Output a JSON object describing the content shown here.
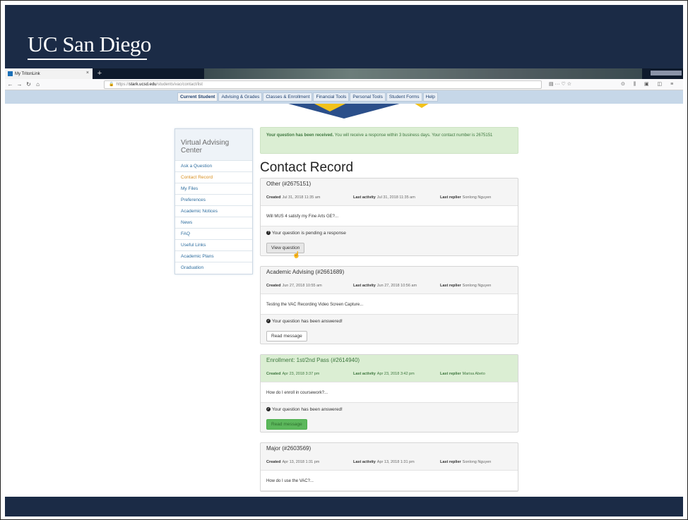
{
  "slide": {
    "logo_text": "UC San Diego"
  },
  "browser": {
    "tab_title": "My TritonLink",
    "tab_close": "×",
    "new_tab": "+",
    "back": "←",
    "forward": "→",
    "reload": "↻",
    "home": "⌂",
    "url_prefix": "https://",
    "url_host": "stark.ucsd.edu",
    "url_path": "/students/vac/contact/list",
    "url_tools": "▤   ··· ♡ ☆",
    "toolbar_icons": "⊙ ⫼ ▣ ◫ ≡"
  },
  "menu": {
    "items": [
      "Current Student",
      "Advising & Grades",
      "Classes & Enrollment",
      "Financial Tools",
      "Personal Tools",
      "Student Forms",
      "Help"
    ]
  },
  "sidebar": {
    "title": "Virtual Advising Center",
    "items": [
      "Ask a Question",
      "Contact Record",
      "My Files",
      "Preferences",
      "Academic Notices",
      "News",
      "FAQ",
      "Useful Links",
      "Academic Plans",
      "Graduation"
    ]
  },
  "alert": {
    "bold": "Your question has been received.",
    "rest": " You will receive a response within 3 business days. Your contact number is 2675151"
  },
  "heading": "Contact Record",
  "labels": {
    "created": "Created",
    "last_activity": "Last activity",
    "last_replier": "Last replier"
  },
  "cards": [
    {
      "title": "Other (#2675151)",
      "created": "Jul 31, 2018 11:35 am",
      "last_activity": "Jul 31, 2018 11:35 am",
      "last_replier": "Sonlong Nguyen",
      "body": "Will MUS 4 satisfy my Fine Arts GE?...",
      "status": "Your question is pending a response",
      "status_icon": "?",
      "button": "View question"
    },
    {
      "title": "Academic Advising (#2661689)",
      "created": "Jun 27, 2018 10:55 am",
      "last_activity": "Jun 27, 2018 10:56 am",
      "last_replier": "Sonlong Nguyen",
      "body": "Testing the VAC Recording Video Screen Capture...",
      "status": "Your question has been answered!",
      "status_icon": "✓",
      "button": "Read message"
    },
    {
      "title": "Enrollment: 1st/2nd Pass (#2614940)",
      "created": "Apr 23, 2018 3:37 pm",
      "last_activity": "Apr 23, 2018 3:42 pm",
      "last_replier": "Marisa Abeto",
      "body": "How do I enroll in coursework?...",
      "status": "Your question has been answered!",
      "status_icon": "✓",
      "button": "Read message"
    },
    {
      "title": "Major (#2603569)",
      "created": "Apr 13, 2018 1:31 pm",
      "last_activity": "Apr 13, 2018 1:31 pm",
      "last_replier": "Sonlong Nguyen",
      "body": "How do I use the VAC?..."
    }
  ],
  "cursor": "☝"
}
